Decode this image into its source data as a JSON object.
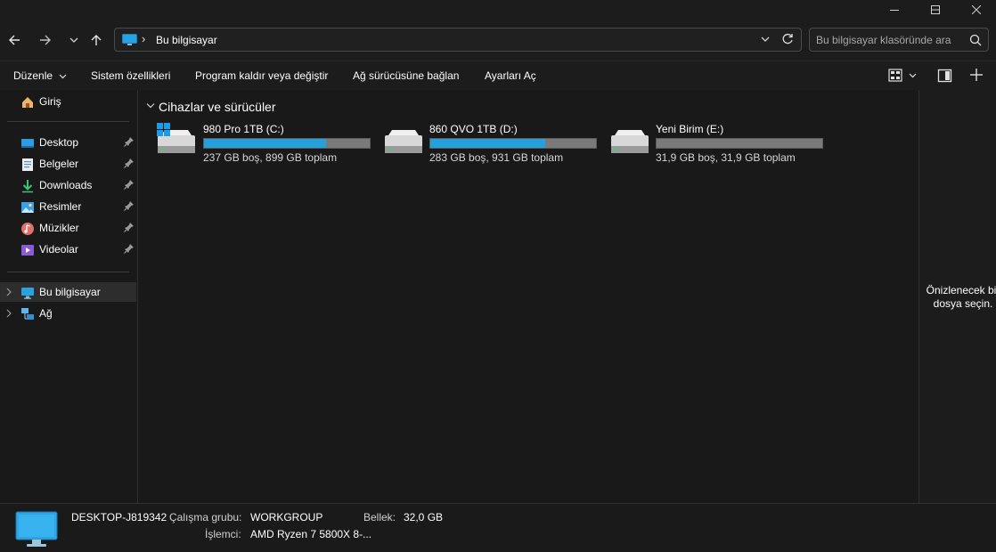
{
  "window": {
    "controls": {
      "minimize": "—",
      "maximize": "☐",
      "close": "✕"
    }
  },
  "address": {
    "path": "Bu bilgisayar",
    "separator": "›"
  },
  "search": {
    "placeholder": "Bu bilgisayar klasöründe ara"
  },
  "commands": {
    "organize": "Düzenle",
    "system_properties": "Sistem özellikleri",
    "uninstall": "Program kaldır veya değiştir",
    "map_drive": "Ağ sürücüsüne bağlan",
    "open_settings": "Ayarları Aç"
  },
  "sidebar": {
    "home": "Giriş",
    "quick": [
      {
        "label": "Desktop",
        "icon": "desktop-icon"
      },
      {
        "label": "Belgeler",
        "icon": "documents-icon"
      },
      {
        "label": "Downloads",
        "icon": "downloads-icon"
      },
      {
        "label": "Resimler",
        "icon": "pictures-icon"
      },
      {
        "label": "Müzikler",
        "icon": "music-icon"
      },
      {
        "label": "Videolar",
        "icon": "videos-icon"
      }
    ],
    "this_pc": "Bu bilgisayar",
    "network": "Ağ"
  },
  "main": {
    "group_title": "Cihazlar ve sürücüler",
    "drives": [
      {
        "name": "980 Pro 1TB (C:)",
        "info": "237 GB boş, 899 GB toplam",
        "used_fraction": 0.736,
        "system": true
      },
      {
        "name": "860 QVO 1TB (D:)",
        "info": "283 GB boş, 931 GB toplam",
        "used_fraction": 0.696,
        "system": false
      },
      {
        "name": "Yeni Birim (E:)",
        "info": "31,9 GB boş, 31,9 GB toplam",
        "used_fraction": 0.0,
        "system": false
      }
    ]
  },
  "preview": {
    "line1": "Önizlenecek bir",
    "line2": "dosya seçin."
  },
  "details": {
    "computer_name": "DESKTOP-J819342",
    "workgroup_label": "Çalışma grubu:",
    "workgroup_value": "WORKGROUP",
    "memory_label": "Bellek:",
    "memory_value": "32,0 GB",
    "processor_label": "İşlemci:",
    "processor_value": "AMD Ryzen 7 5800X 8-..."
  },
  "colors": {
    "accent": "#26a0da",
    "background": "#191919",
    "bar_track": "#7a7a7a"
  }
}
